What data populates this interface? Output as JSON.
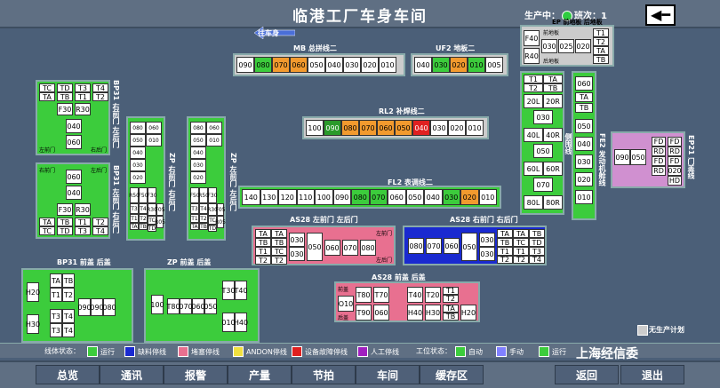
{
  "header": {
    "title": "临港工厂车身车间",
    "status_label": "生产中：",
    "shift_label": "班次：1",
    "back_icon": "left-arrow-icon"
  },
  "direction_label": "往车身",
  "mb": {
    "title": "MB 总拼线二",
    "stations": [
      [
        "090",
        "w"
      ],
      [
        "080",
        "g"
      ],
      [
        "070",
        "o"
      ],
      [
        "060",
        "o"
      ],
      [
        "050",
        "w"
      ],
      [
        "040",
        "w"
      ],
      [
        "030",
        "w"
      ],
      [
        "020",
        "w"
      ],
      [
        "010",
        "w"
      ]
    ]
  },
  "uf2": {
    "title": "UF2 地板二",
    "stations": [
      [
        "040",
        "w"
      ],
      [
        "030",
        "g"
      ],
      [
        "020",
        "o"
      ],
      [
        "010",
        "g"
      ],
      [
        "005",
        "w"
      ]
    ]
  },
  "rl2": {
    "title": "RL2 补焊线二",
    "stations": [
      [
        "100",
        "w"
      ],
      [
        "090",
        "dg"
      ],
      [
        "080",
        "o"
      ],
      [
        "070",
        "o"
      ],
      [
        "060",
        "o"
      ],
      [
        "050",
        "o"
      ],
      [
        "040",
        "r"
      ],
      [
        "030",
        "w"
      ],
      [
        "020",
        "w"
      ],
      [
        "010",
        "w"
      ]
    ]
  },
  "fl2": {
    "title": "FL2 表调线二",
    "stations": [
      [
        "140",
        "w"
      ],
      [
        "130",
        "w"
      ],
      [
        "120",
        "w"
      ],
      [
        "110",
        "w"
      ],
      [
        "100",
        "w"
      ],
      [
        "090",
        "w"
      ],
      [
        "080",
        "g"
      ],
      [
        "070",
        "g"
      ],
      [
        "060",
        "w"
      ],
      [
        "050",
        "w"
      ],
      [
        "040",
        "w"
      ],
      [
        "030",
        "g"
      ],
      [
        "020",
        "o"
      ],
      [
        "010",
        "w"
      ]
    ]
  },
  "ep": {
    "title": "EP 前地板 后地板",
    "front": "前地板",
    "rear": "后地板",
    "f40": "F40",
    "r40": "R40",
    "s030": "030",
    "s025": "025",
    "s020": "020",
    "t1": "T1",
    "t2": "T2",
    "ta": "TA",
    "tb": "TB"
  },
  "bl": {
    "title": "侧围线",
    "cells": [
      "T1",
      "TA",
      "T2",
      "TB",
      "20L",
      "20R",
      "030",
      "40L",
      "40R",
      "050",
      "60L",
      "60R",
      "070",
      "80L",
      "80R"
    ]
  },
  "fe2": {
    "title": "FE2 发动机舱线",
    "cells": [
      "060",
      "TA",
      "TB",
      "050",
      "040",
      "030",
      "020",
      "010"
    ]
  },
  "ep21": {
    "title": "EP21 门盖线",
    "s090": "090",
    "s050": "050",
    "fd": "FD",
    "rd": "RD",
    "s020": "020",
    "hd": "HD"
  },
  "bp31a": {
    "title": "BP31 右前门 左后门",
    "tc": "TC",
    "td": "TD",
    "t3": "T3",
    "t4": "T4",
    "ta": "TA",
    "tb": "TB",
    "t1": "T1",
    "t2": "T2",
    "f30": "F30",
    "r30": "R30",
    "s040": "040",
    "s060": "060",
    "left_front": "左前门",
    "right_rear": "右后门"
  },
  "bp31b": {
    "title": "BP31 左前门 右后门",
    "s060": "060",
    "s040": "040",
    "f30": "F30",
    "r30": "R30",
    "ta": "TA",
    "tb": "TB",
    "t1": "T1",
    "t2": "T2",
    "tc": "TC",
    "td": "TD",
    "t3": "T3",
    "t4": "T4",
    "right_front": "右前门",
    "left_rear": "左后门"
  },
  "zp1": {
    "title": "ZP 右前门 右后门",
    "cells": [
      "080",
      "060",
      "050",
      "040",
      "030",
      "020",
      "010",
      "R50",
      "F50",
      "F30",
      "R30",
      "T3",
      "T4",
      "T1",
      "T2",
      "TA",
      "TB",
      "TC",
      "TD",
      "F05",
      "R05"
    ]
  },
  "zp2": {
    "title": "ZP 左前门 左后门",
    "cells": [
      "080",
      "060",
      "050",
      "040",
      "030",
      "020",
      "010",
      "F50",
      "R50",
      "F30",
      "R30",
      "T3",
      "T4",
      "T1",
      "T2",
      "TA",
      "TB",
      "TC",
      "TD",
      "F05",
      "R05"
    ]
  },
  "as28l": {
    "title": "AS28 左前门 左后门",
    "ta": "TA",
    "tb": "TB",
    "t1": "T1",
    "t2": "T2",
    "tc": "TC",
    "td": "TD",
    "t3": "T3",
    "t4": "T4",
    "s030": "030",
    "s050": "050",
    "s060": "060",
    "s070": "070",
    "s080": "080",
    "lf": "左前门",
    "lr": "左后门"
  },
  "as28r": {
    "title": "AS28 右前门 右后门",
    "s080": "080",
    "s070": "070",
    "s060": "060",
    "s050": "050",
    "s030": "030",
    "ta": "TA",
    "tb": "TB",
    "t1": "T1",
    "t2": "T2",
    "tc": "TC",
    "td": "TD",
    "t3": "T3",
    "t4": "T4"
  },
  "as28h": {
    "title": "AS28 前盖 后盖",
    "front": "前盖",
    "rear": "后盖",
    "t80": "T80",
    "t70": "T70",
    "t40": "T40",
    "t20": "T20",
    "t1": "T1",
    "t2": "T2",
    "o10": "O10",
    "t90": "T90",
    "s060": "060",
    "h40": "H40",
    "h30": "H30",
    "ta": "TA",
    "tb": "TB",
    "h20": "H20"
  },
  "bp31h": {
    "title": "BP31 前盖 后盖",
    "h20": "H20",
    "h30": "H30",
    "ta": "TA",
    "tb": "TB",
    "t1": "T1",
    "t2": "T2",
    "t3": "T3",
    "t4": "T4",
    "s090": "090",
    "s080": "080"
  },
  "zph": {
    "title": "ZP 前盖 后盖",
    "s100": "100",
    "t80": "T80",
    "s070": "070",
    "s060": "060",
    "s050": "050",
    "t30": "T30",
    "t40": "T40",
    "s010": "010",
    "h40": "H40"
  },
  "no_plan": "无生产计划",
  "legend": {
    "line_label": "线体状态：",
    "station_label": "工位状态：",
    "items": [
      {
        "label": "运行",
        "color": "#3ccc3c"
      },
      {
        "label": "缺料停线",
        "color": "#1a2ad0"
      },
      {
        "label": "堵塞停线",
        "color": "#e87090"
      },
      {
        "label": "ANDON停线",
        "color": "#f0e040"
      },
      {
        "label": "设备故障停线",
        "color": "#e02020"
      },
      {
        "label": "人工停线",
        "color": "#a020c0"
      },
      {
        "label": "自动",
        "color": "#3ccc3c"
      },
      {
        "label": "手动",
        "color": "#8080ff"
      },
      {
        "label": "运行",
        "color": "#3ccc3c"
      }
    ]
  },
  "nav": {
    "items": [
      "总览",
      "通讯",
      "报警",
      "产量",
      "节拍",
      "车间",
      "缓存区"
    ],
    "back": "返回",
    "exit": "退出"
  },
  "watermark": "上海经信委"
}
